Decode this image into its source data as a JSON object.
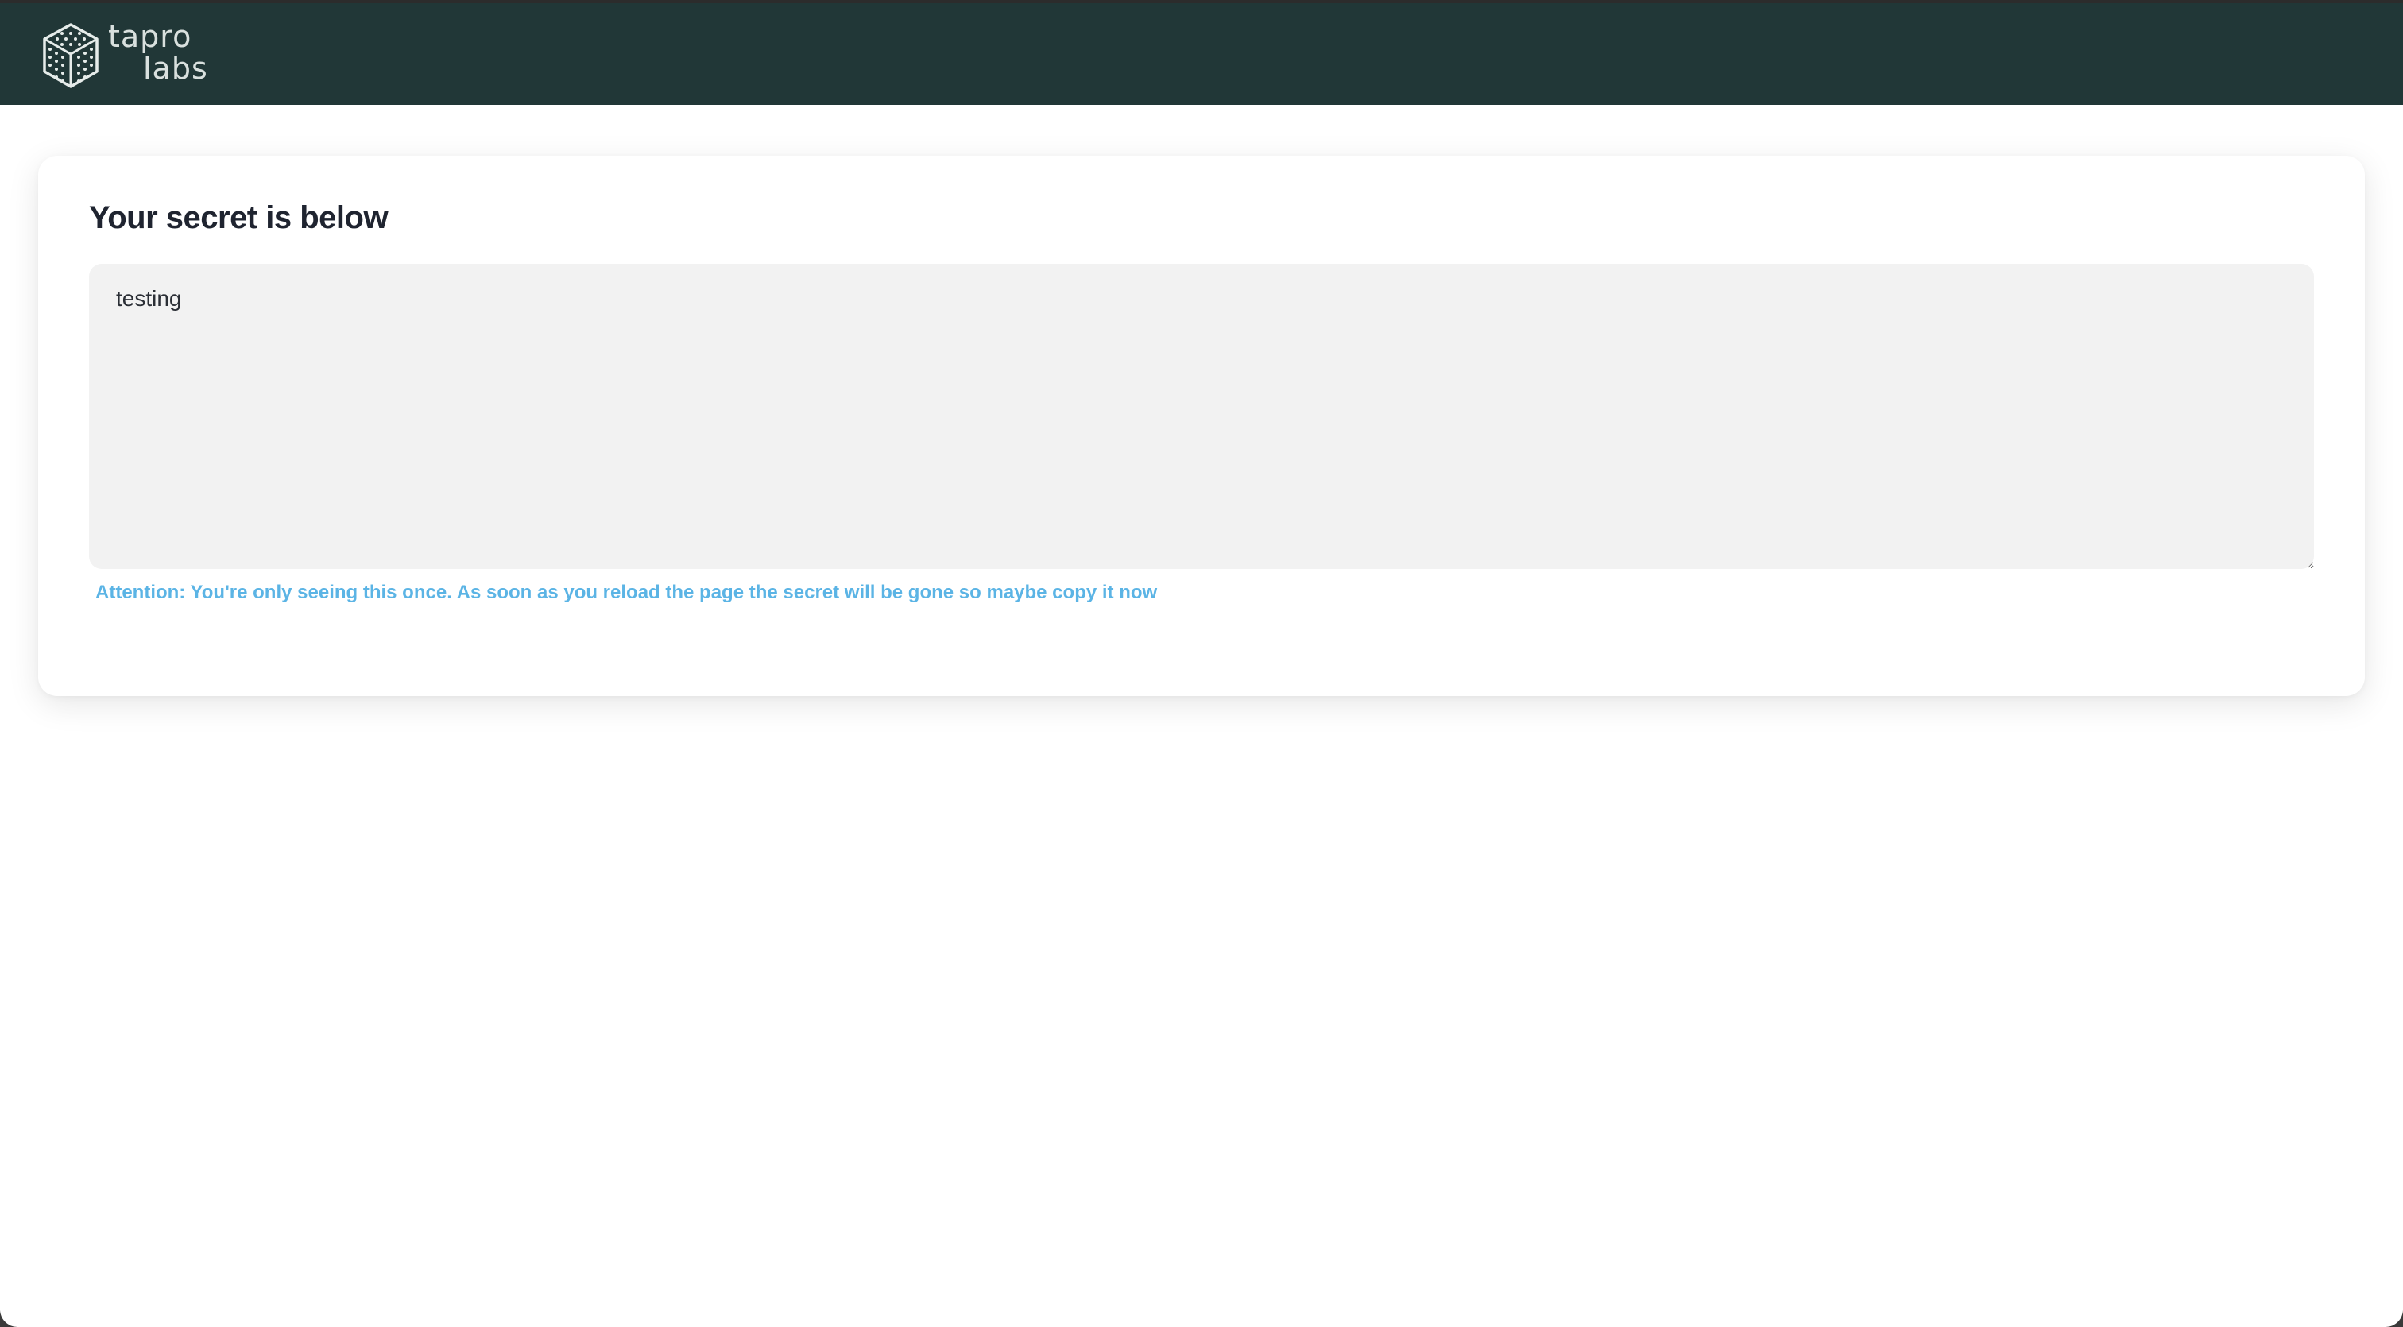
{
  "header": {
    "brand_line1": "tapro",
    "brand_line2": "labs",
    "background_color": "#213737",
    "logo_icon": "cube-icon"
  },
  "main": {
    "title": "Your secret is below",
    "secret_value": "testing",
    "attention_text": "Attention: You're only seeing this once. As soon as you reload the page the secret will be gone so maybe copy it now",
    "attention_color": "#5bb4e5"
  }
}
